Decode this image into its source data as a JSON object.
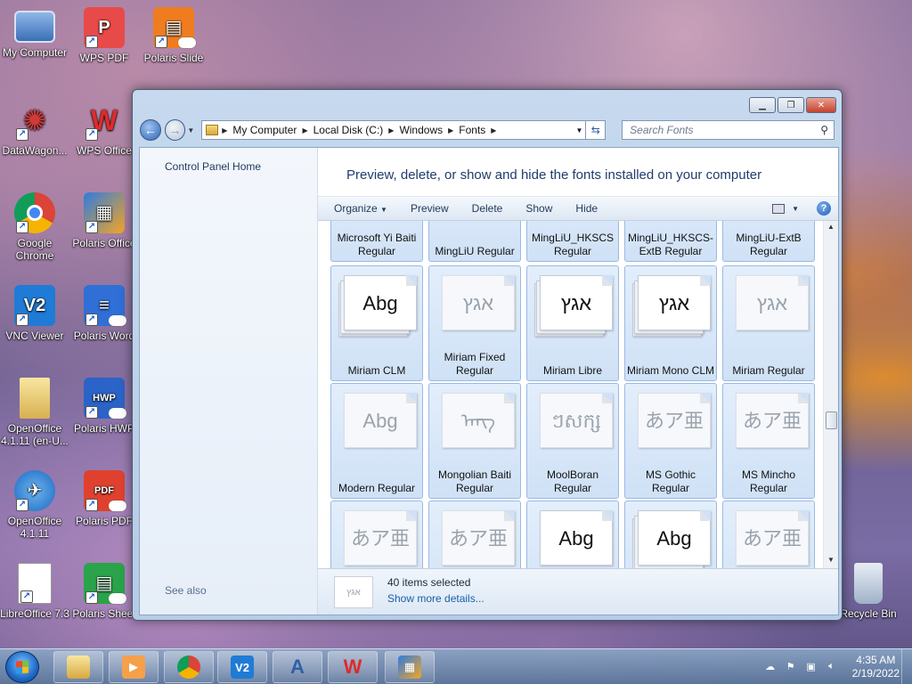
{
  "desktop": {
    "icons": [
      {
        "label": "My Computer",
        "icon": "computer-icon"
      },
      {
        "label": "WPS PDF",
        "icon": "wps-pdf-icon"
      },
      {
        "label": "Polaris Slide",
        "icon": "polaris-slide-icon"
      },
      {
        "label": "DataWagon...",
        "icon": "datawagon-icon"
      },
      {
        "label": "WPS Office",
        "icon": "wps-office-icon"
      },
      {
        "label": "Google Chrome",
        "icon": "chrome-icon"
      },
      {
        "label": "Polaris Office",
        "icon": "polaris-office-icon"
      },
      {
        "label": "VNC Viewer",
        "icon": "vnc-viewer-icon"
      },
      {
        "label": "Polaris Word",
        "icon": "polaris-word-icon"
      },
      {
        "label": "OpenOffice 4.1.11 (en-U...",
        "icon": "folder-icon"
      },
      {
        "label": "Polaris HWP",
        "icon": "polaris-hwp-icon"
      },
      {
        "label": "OpenOffice 4.1.11",
        "icon": "openoffice-icon"
      },
      {
        "label": "Polaris PDF",
        "icon": "polaris-pdf-icon"
      },
      {
        "label": "LibreOffice 7.3",
        "icon": "libreoffice-icon"
      },
      {
        "label": "Polaris Sheet",
        "icon": "polaris-sheet-icon"
      },
      {
        "label": "Recycle Bin",
        "icon": "recycle-bin-icon"
      }
    ]
  },
  "window": {
    "address": {
      "crumbs": [
        "My Computer",
        "Local Disk (C:)",
        "Windows",
        "Fonts"
      ]
    },
    "search_placeholder": "Search Fonts",
    "left_pane": {
      "control_panel_home": "Control Panel Home",
      "see_also": "See also"
    },
    "header_text": "Preview, delete, or show and hide the fonts installed on your computer",
    "commands": {
      "organize": "Organize",
      "preview": "Preview",
      "delete": "Delete",
      "show": "Show",
      "hide": "Hide"
    },
    "fonts": [
      {
        "label": "Microsoft Yi Baiti Regular",
        "sample": "",
        "style": "normal"
      },
      {
        "label": "MingLiU Regular",
        "sample": "",
        "style": "normal"
      },
      {
        "label": "MingLiU_HKSCS Regular",
        "sample": "",
        "style": "normal"
      },
      {
        "label": "MingLiU_HKSCS-ExtB Regular",
        "sample": "",
        "style": "normal"
      },
      {
        "label": "MingLiU-ExtB Regular",
        "sample": "",
        "style": "normal"
      },
      {
        "label": "Miriam CLM",
        "sample": "Abg",
        "style": "family"
      },
      {
        "label": "Miriam Fixed Regular",
        "sample": "אגץ",
        "style": "faded"
      },
      {
        "label": "Miriam Libre",
        "sample": "אגץ",
        "style": "family"
      },
      {
        "label": "Miriam Mono CLM",
        "sample": "אגץ",
        "style": "family"
      },
      {
        "label": "Miriam Regular",
        "sample": "אגץ",
        "style": "faded"
      },
      {
        "label": "Modern Regular",
        "sample": "Abg",
        "style": "faded"
      },
      {
        "label": "Mongolian Baiti Regular",
        "sample": "ᠠᠨᠭ",
        "style": "faded"
      },
      {
        "label": "MoolBoran Regular",
        "sample": "ៗសក្ស",
        "style": "faded"
      },
      {
        "label": "MS Gothic Regular",
        "sample": "あア亜",
        "style": "faded"
      },
      {
        "label": "MS Mincho Regular",
        "sample": "あア亜",
        "style": "faded"
      },
      {
        "label": "",
        "sample": "あア亜",
        "style": "faded"
      },
      {
        "label": "",
        "sample": "あア亜",
        "style": "faded"
      },
      {
        "label": "",
        "sample": "Abg",
        "style": "single"
      },
      {
        "label": "",
        "sample": "Abg",
        "style": "family"
      },
      {
        "label": "",
        "sample": "あア亜",
        "style": "faded"
      }
    ],
    "details": {
      "preview_sample": "אגץ",
      "count": "40 items selected",
      "more": "Show more details..."
    }
  },
  "taskbar": {
    "clock_time": "4:35 AM",
    "clock_date": "2/19/2022"
  }
}
